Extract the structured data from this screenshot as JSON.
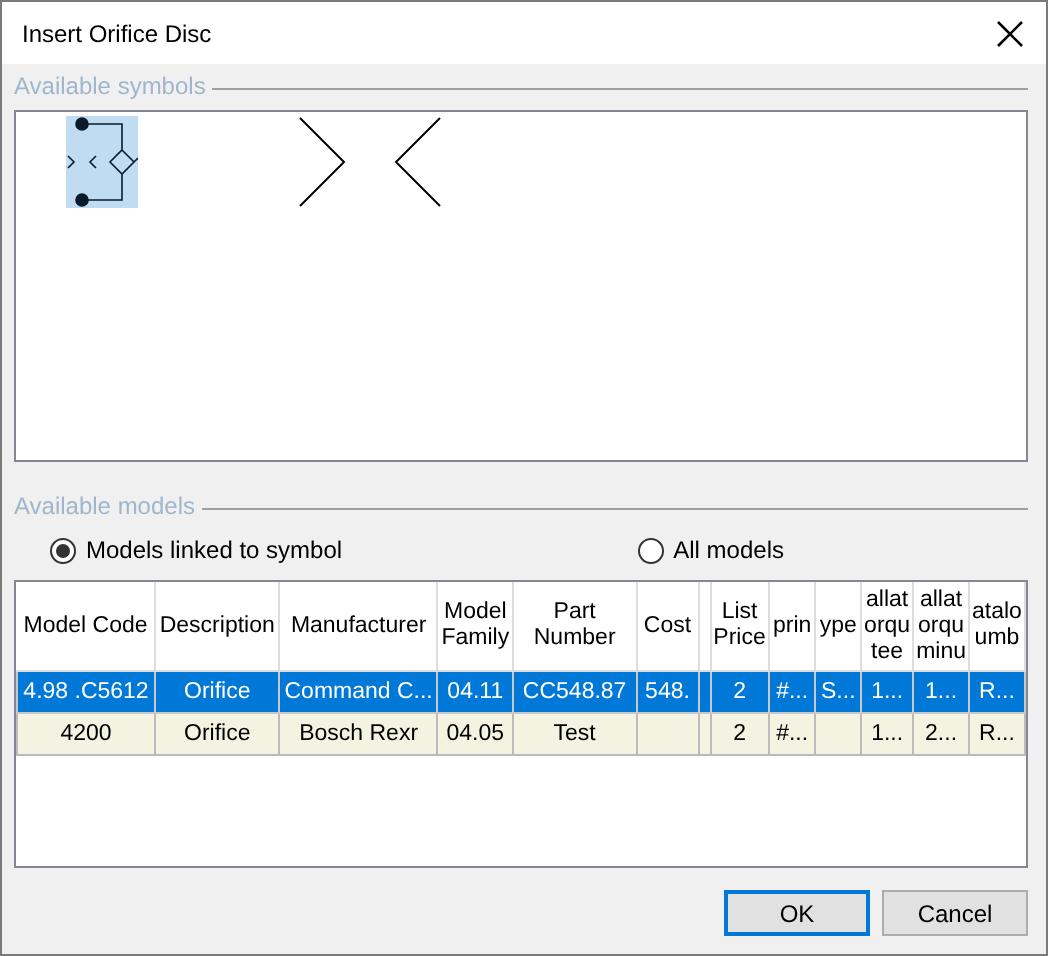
{
  "window": {
    "title": "Insert Orifice Disc"
  },
  "symbols_group": {
    "label": "Available symbols",
    "items": [
      {
        "kind": "orifice-check",
        "selected": true
      },
      {
        "kind": "orifice",
        "selected": false
      }
    ]
  },
  "models_group": {
    "label": "Available models",
    "filters": [
      {
        "label": "Models linked to symbol",
        "selected": true
      },
      {
        "label": "All models",
        "selected": false
      }
    ]
  },
  "table": {
    "columns": [
      "Model Code",
      "Description",
      "Manufacturer",
      "Model Family",
      "Part Number",
      "Cost",
      "",
      "List Price",
      "prin",
      "ype",
      "allat orqu tee",
      "allat orqu minu",
      "atalo umb"
    ],
    "rows": [
      {
        "selected": true,
        "cells": [
          "4.98 .C5612",
          "Orifice",
          "Command C...",
          "04.11",
          "CC548.87",
          "548.",
          "",
          "2",
          "#...",
          "S...",
          "1...",
          "1...",
          "R..."
        ]
      },
      {
        "selected": false,
        "cells": [
          "4200",
          "Orifice",
          "Bosch Rexr",
          "04.05",
          "Test",
          "",
          "",
          "2",
          "#...",
          "",
          "1...",
          "2...",
          "R..."
        ]
      }
    ]
  },
  "buttons": [
    {
      "label": "OK",
      "default": true
    },
    {
      "label": "Cancel",
      "default": false
    }
  ]
}
